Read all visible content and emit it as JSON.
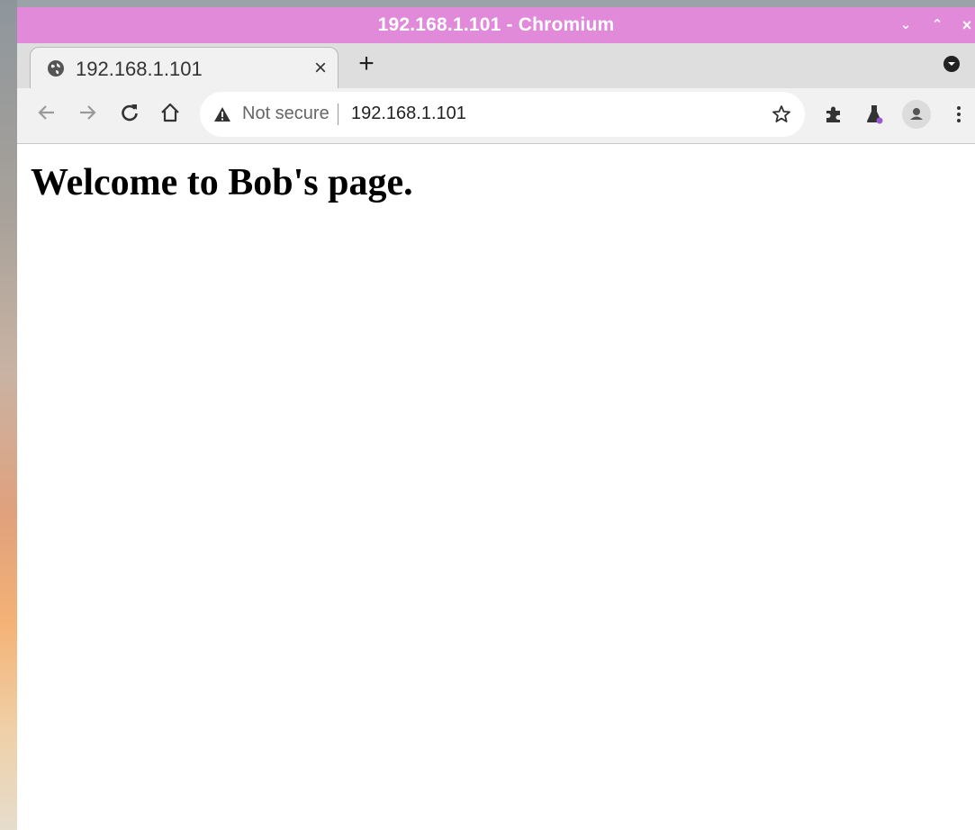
{
  "window": {
    "title": "192.168.1.101 - Chromium",
    "controls": {
      "minimize": "⌄",
      "maximize": "⌃",
      "close": "×"
    }
  },
  "tabs": [
    {
      "title": "192.168.1.101",
      "favicon": "globe-icon",
      "active": true,
      "close_label": "×"
    }
  ],
  "new_tab_label": "+",
  "toolbar": {
    "security_label": "Not secure",
    "url": "192.168.1.101"
  },
  "page": {
    "heading": "Welcome to Bob's page."
  },
  "colors": {
    "titlebar": "#e08ad9",
    "toolbar": "#f1f1f1",
    "tabstrip": "#dedede"
  }
}
